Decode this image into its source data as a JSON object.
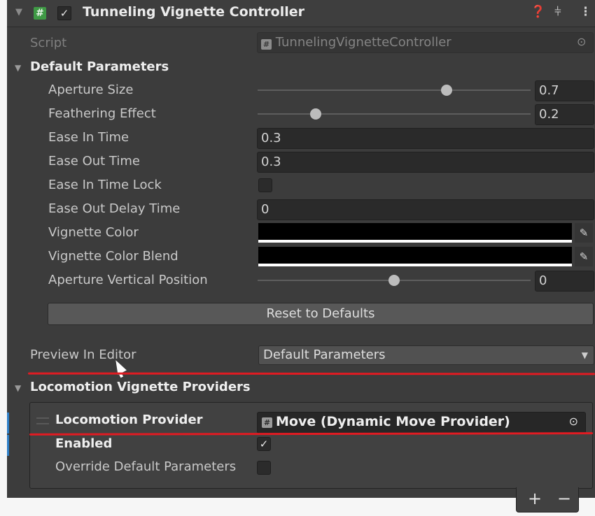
{
  "header": {
    "title": "Tunneling Vignette Controller",
    "enabled": true,
    "icons": [
      "foldout-arrow",
      "script-hash-icon",
      "checkbox-icon",
      "help-icon",
      "presets-icon",
      "kebab-menu-icon"
    ]
  },
  "script": {
    "label": "Script",
    "value": "TunnelingVignetteController"
  },
  "default_parameters": {
    "label": "Default Parameters",
    "aperture_size": {
      "label": "Aperture Size",
      "value": "0.7",
      "fraction": 0.7
    },
    "feathering_effect": {
      "label": "Feathering Effect",
      "value": "0.2",
      "fraction": 0.2
    },
    "ease_in_time": {
      "label": "Ease In Time",
      "value": "0.3"
    },
    "ease_out_time": {
      "label": "Ease Out Time",
      "value": "0.3"
    },
    "ease_in_time_lock": {
      "label": "Ease In Time Lock",
      "checked": false
    },
    "ease_out_delay_time": {
      "label": "Ease Out Delay Time",
      "value": "0"
    },
    "vignette_color": {
      "label": "Vignette Color",
      "color": "#000000"
    },
    "vignette_color_blend": {
      "label": "Vignette Color Blend",
      "color": "#000000"
    },
    "aperture_vertical_position": {
      "label": "Aperture Vertical Position",
      "value": "0",
      "fraction": 0.5
    },
    "reset_button": "Reset to Defaults"
  },
  "preview": {
    "label": "Preview In Editor",
    "selected": "Default Parameters"
  },
  "providers": {
    "label": "Locomotion Vignette Providers",
    "item": {
      "provider_label": "Locomotion Provider",
      "provider_value": "Move (Dynamic Move Provider)",
      "enabled_label": "Enabled",
      "enabled": true,
      "override_label": "Override Default Parameters",
      "override": false
    },
    "add_label": "+",
    "remove_label": "−"
  },
  "colors": {
    "annotation_red": "#e11b22",
    "script_icon_green": "#3f9a45",
    "selection_blue": "#2e7fc7"
  }
}
